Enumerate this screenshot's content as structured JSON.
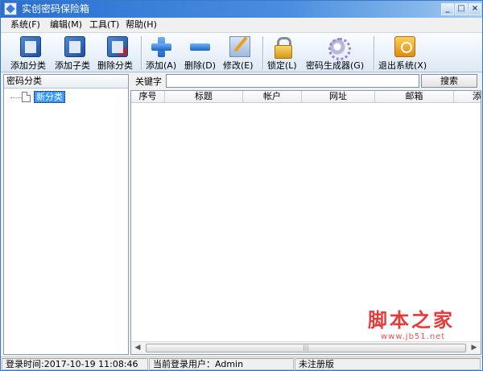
{
  "window": {
    "title": "实创密码保险箱",
    "min_symbol": "_",
    "max_symbol": "□",
    "close_symbol": "×"
  },
  "menu": {
    "items": [
      "系统(F)",
      "编辑(M)",
      "工具(T)",
      "帮助(H)"
    ]
  },
  "toolbar": {
    "items": [
      {
        "label": "添加分类",
        "icon": "book-add-icon"
      },
      {
        "label": "添加子类",
        "icon": "book-sub-icon"
      },
      {
        "label": "删除分类",
        "icon": "book-delete-icon"
      },
      {
        "label": "添加(A)",
        "icon": "plus-icon"
      },
      {
        "label": "删除(D)",
        "icon": "minus-icon"
      },
      {
        "label": "修改(E)",
        "icon": "edit-icon"
      },
      {
        "label": "锁定(L)",
        "icon": "lock-icon"
      },
      {
        "label": "密码生成器(G)",
        "icon": "gear-icon"
      },
      {
        "label": "退出系统(X)",
        "icon": "power-icon"
      }
    ]
  },
  "left_panel": {
    "header": "密码分类",
    "tree": [
      {
        "label": "新分类",
        "selected": true
      }
    ]
  },
  "search": {
    "label": "关键字",
    "value": "",
    "button": "搜索"
  },
  "table": {
    "columns": [
      "序号",
      "标题",
      "帐户",
      "网址",
      "邮箱",
      "添加"
    ],
    "rows": []
  },
  "scrollbar": {
    "left_arrow": "◀",
    "right_arrow": "▶",
    "grip": "|||"
  },
  "watermark": {
    "main": "脚本之家",
    "sub": "www.jb51.net"
  },
  "status": {
    "login_time": "登录时间:2017-10-19 11:08:46",
    "current_user": "当前登录用户：Admin",
    "registration": "未注册版"
  },
  "colors": {
    "title_bar": "#2a6fd0",
    "selection": "#3399ff",
    "watermark": "#e53b3b"
  }
}
